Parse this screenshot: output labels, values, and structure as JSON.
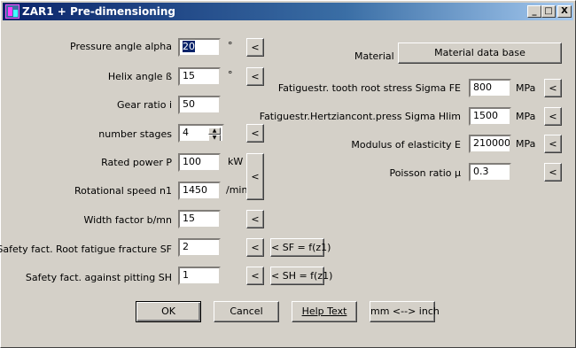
{
  "window": {
    "title": "ZAR1 + Pre-dimensioning"
  },
  "title_buttons": {
    "minimize": "_",
    "maximize": "□",
    "close": "X"
  },
  "left": {
    "pressure_angle": {
      "label": "Pressure angle alpha",
      "value": "20",
      "unit": "°",
      "btn": "<"
    },
    "helix_angle": {
      "label": "Helix angle ß",
      "value": "15",
      "unit": "°",
      "btn": "<"
    },
    "gear_ratio": {
      "label": "Gear ratio i",
      "value": "50"
    },
    "stages": {
      "label": "number stages",
      "value": "4",
      "btn": "<"
    },
    "power": {
      "label": "Rated power P",
      "value": "100",
      "unit": "kW"
    },
    "speed": {
      "label": "Rotational speed n1",
      "value": "1450",
      "unit": "/min"
    },
    "power_speed_btn": "<",
    "width_factor": {
      "label": "Width factor b/mn",
      "value": "15",
      "btn": "<"
    },
    "sf": {
      "label": "Safety fact. Root fatigue fracture SF",
      "value": "2",
      "btn": "<",
      "formula_btn": "< SF = f(z1)"
    },
    "sh": {
      "label": "Safety fact. against pitting SH",
      "value": "1",
      "btn": "<",
      "formula_btn": "< SH = f(z1)"
    }
  },
  "right": {
    "material_label": "Material",
    "material_btn": "Material data base",
    "fe": {
      "label": "Fatiguestr. tooth root stress Sigma FE",
      "value": "800",
      "unit": "MPa",
      "btn": "<"
    },
    "hlim": {
      "label": "Fatiguestr.Hertziancont.press Sigma Hlim",
      "value": "1500",
      "unit": "MPa",
      "btn": "<"
    },
    "modulus": {
      "label": "Modulus of elasticity E",
      "value": "210000",
      "unit": "MPa",
      "btn": "<"
    },
    "poisson": {
      "label": "Poisson ratio µ",
      "value": "0.3",
      "btn": "<"
    }
  },
  "footer": {
    "ok": "OK",
    "cancel": "Cancel",
    "help": "Help Text",
    "units": "mm <--> inch"
  }
}
